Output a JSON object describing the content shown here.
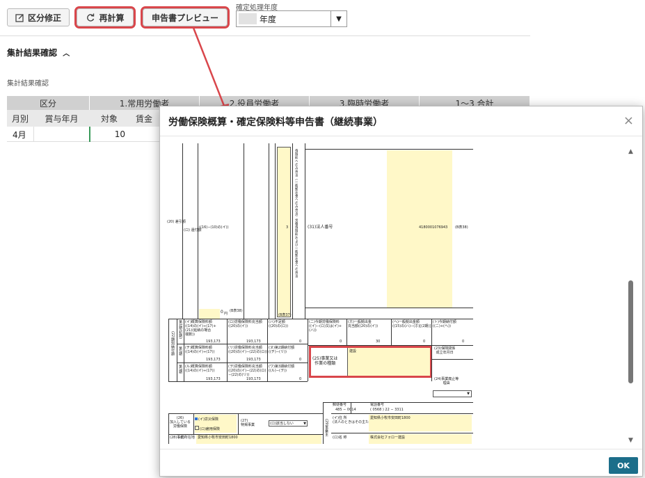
{
  "toolbar": {
    "kubun_label": "区分修正",
    "recalc_label": "再計算",
    "preview_label": "申告書プレビュー",
    "year_caption": "確定処理年度",
    "year_value": "年度",
    "year_arrow": "▼"
  },
  "section": {
    "title": "集計結果確認",
    "subtitle": "集計結果確認"
  },
  "table": {
    "header_top": [
      "区分",
      "1.常用労働者",
      "2.役員労働者",
      "3.臨時労働者",
      "1〜3 合計"
    ],
    "header_sub": [
      "月別",
      "賞与年月",
      "対象",
      "賃金"
    ],
    "row1": {
      "month": "4月",
      "bonus": "",
      "count": "10"
    }
  },
  "modal": {
    "title": "労働保険概算・確定保険料等申告書（継続事業）",
    "close": "×",
    "ok_label": "OK"
  },
  "doc": {
    "deduct_label": "(20)\n差引額",
    "refund_label": "(ロ)\n還付額",
    "refund_formula": "((16)−(10)の(イ))",
    "small3": "3",
    "v_long": "保険料へのみ充当（一般拠出金へのみ充当）労働保険料および一般拠出金への充当",
    "corp_label": "(31)法人番号",
    "corp_number": "4180001076943",
    "corp_page": "(B表38)",
    "zero_yen": "0",
    "yen": "円",
    "b38": "(B表38)",
    "b37": "(B表37)",
    "sec22": "(22)期別納付額",
    "period1": "第1期(初期)",
    "period2": "第2期",
    "period3": "第3期",
    "c1_label": "(イ)概算保険料額\n((14)の(イ)÷(17)+\n(21)(延納の場合\n端数))",
    "c1_value": "193,173",
    "c2_label": "(ロ)労働保険料充当額\n((20)の(イ))",
    "c2_value": "193,173",
    "c3_label": "(ハ)不足額\n((20)の(ロ))",
    "c3_value": "0",
    "c4_label": "(ニ)今期労働保険料\n((イ)−(ロ)又は(イ)+\n(ハ))",
    "c4_value": "0",
    "c5_label": "(ホ)一般拠出金\n充当額((20)の(イ))",
    "c5_value": "30",
    "c6_label": "(ヘ)一般拠出金額\n((15)の(ハ)−(ホ)[(2期)]",
    "c6_value": "0",
    "c7_label": "(ト)今期納付額\n((ニ)+(ヘ))",
    "c7_value": "0",
    "r2a_label": "(チ)概算保険料額\n((14)の(イ)÷(17))",
    "r2a_value": "193,173",
    "r2b_label": "(リ)労働保険料充当額\n((20)の(イ)−(22)の(ロ))",
    "r2b_value": "193,173",
    "r2c_label": "(ヌ)第2期納付額\n((チ)−(リ))",
    "r2c_value": "0",
    "r3a_label": "(ル)概算保険料額\n((14)の(イ)÷(17))",
    "r3a_value": "193,173",
    "r3b_label": "(ヲ)労働保険料充当額\n((20)の(イ)−(22)の(ロ)\n−(22)の(リ))",
    "r3b_value": "193,173",
    "r3c_label": "(ワ)第3期納付額\n((ル)−(ヲ))",
    "r3c_value": "0",
    "b25_label": "(25)事業又は\n作業の種類",
    "b25_value": "建設",
    "b23_label": "(23)保険関係\n成立年月日",
    "b24_label": "(24)事業廃止等\n理由",
    "b26_label": "(26)\n加入している\n労働保険",
    "b26_opt1": "(イ)労災保険",
    "b26_opt2": "(ロ)雇用保険",
    "b27_label": "(27)\n特掲事業",
    "b27_value": "(ロ)該当しない",
    "zip_label": "郵便番号",
    "zip_value": "485 − 0014",
    "tel_label": "電話番号",
    "tel_value": "( 0568 ) 22 − 3311",
    "addr_label": "(イ)住 所\n(法人のときはその主たる事務所の所在地)",
    "addr_value": "愛知県小牧市安田町1800",
    "b28_label": "(28)事業",
    "b28_addr_label": "(イ)所在地",
    "b28_addr_value": "愛知県小牧市安田町1800",
    "b29_label": "(29)事業主",
    "name_label": "(ロ)名 称",
    "name_value": "株式会社フォロー建設"
  }
}
